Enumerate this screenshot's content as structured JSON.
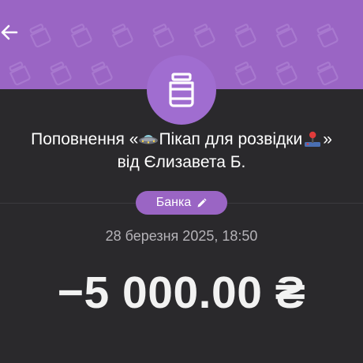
{
  "header": {
    "back_icon": "arrow-left-icon",
    "background_color": "#9a65c4",
    "pattern_icon": "jar-pattern-icon"
  },
  "avatar": {
    "icon": "jar-icon",
    "color": "#a06dd0"
  },
  "transaction": {
    "title_prefix": "Поповнення «",
    "title_emoji_1": "flying-saucer-icon",
    "title_name": "Пікап для розвідки",
    "title_emoji_2": "joystick-icon",
    "title_suffix": "»",
    "from_line": "від Єлизавета Б.",
    "category_label": "Банка",
    "category_edit_icon": "pencil-icon",
    "datetime": "28 березня 2025, 18:50",
    "amount": "−5 000.00 ₴"
  },
  "colors": {
    "accent": "#9a65c4",
    "background": "#2a292c",
    "text_primary": "#ffffff",
    "text_secondary": "#b5b3b8"
  }
}
